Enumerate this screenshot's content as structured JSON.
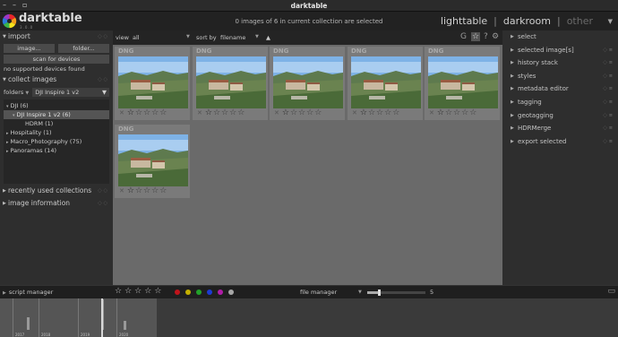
{
  "window": {
    "title": "darktable",
    "controls": [
      "–",
      "▫",
      "×"
    ]
  },
  "app": {
    "name": "darktable",
    "version": "3.0.0"
  },
  "header": {
    "selection_status": "0 images of 6 in current collection are selected",
    "views": {
      "lighttable": "lighttable",
      "darkroom": "darkroom",
      "other": "other",
      "sep": "|"
    }
  },
  "left_panel": {
    "import": {
      "title": "import",
      "image_button": "image...",
      "folder_button": "folder...",
      "scan_button": "scan for devices",
      "no_devices": "no supported devices found"
    },
    "collect": {
      "title": "collect images",
      "property": "folders",
      "value": "DJI Inspire 1 v2",
      "tree": [
        {
          "label": "DJI (6)",
          "indent": 0,
          "twisty": "▾",
          "selected": false
        },
        {
          "label": "DJI Inspire 1 v2 (6)",
          "indent": 1,
          "twisty": "▾",
          "selected": true
        },
        {
          "label": "HDRM (1)",
          "indent": 2,
          "twisty": "",
          "selected": false
        },
        {
          "label": "Hospitality (1)",
          "indent": 0,
          "twisty": "▸",
          "selected": false
        },
        {
          "label": "Macro_Photography (75)",
          "indent": 0,
          "twisty": "▸",
          "selected": false
        },
        {
          "label": "Panoramas (14)",
          "indent": 0,
          "twisty": "▸",
          "selected": false
        }
      ]
    },
    "recent": {
      "title": "recently used collections"
    },
    "info": {
      "title": "image information"
    }
  },
  "top_bar": {
    "view_label": "view",
    "view_value": "all",
    "sort_label": "sort by",
    "sort_value": "filename",
    "sort_dir": "▲"
  },
  "thumbnails": [
    {
      "format": "DNG",
      "stars": 0
    },
    {
      "format": "DNG",
      "stars": 0
    },
    {
      "format": "DNG",
      "stars": 0
    },
    {
      "format": "DNG",
      "stars": 0
    },
    {
      "format": "DNG",
      "stars": 0
    },
    {
      "format": "DNG",
      "stars": 0
    }
  ],
  "right_panel": {
    "items": [
      "select",
      "selected image[s]",
      "history stack",
      "styles",
      "metadata editor",
      "tagging",
      "geotagging",
      "HDRMerge",
      "export selected"
    ]
  },
  "bottom_bar": {
    "script_manager": "script manager",
    "layout": "file manager",
    "zoom": "5",
    "zoom_fraction": 0.2,
    "color_labels": [
      {
        "name": "red",
        "color": "#c0141b"
      },
      {
        "name": "yellow",
        "color": "#c4b000"
      },
      {
        "name": "green",
        "color": "#22a22a"
      },
      {
        "name": "blue",
        "color": "#1c3bd3"
      },
      {
        "name": "purple",
        "color": "#b11da8"
      },
      {
        "name": "gray",
        "color": "#a7a7a7"
      }
    ]
  },
  "timeline": {
    "years": [
      "2017",
      "2018",
      "2019",
      "2020"
    ]
  }
}
